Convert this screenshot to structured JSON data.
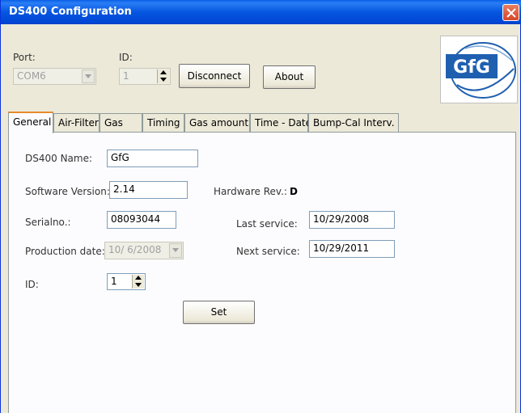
{
  "window": {
    "title": "DS400 Configuration"
  },
  "connection": {
    "port_label": "Port:",
    "port_value": "COM6",
    "id_label": "ID:",
    "id_value": "1",
    "disconnect_label": "Disconnect",
    "about_label": "About"
  },
  "logo": {
    "text": "GfG"
  },
  "tabs": [
    {
      "label": "General",
      "active": true
    },
    {
      "label": "Air-Filter",
      "active": false
    },
    {
      "label": "Gas",
      "active": false
    },
    {
      "label": "Timing",
      "active": false
    },
    {
      "label": "Gas amount",
      "active": false
    },
    {
      "label": "Time - Date",
      "active": false
    },
    {
      "label": "Bump-Cal Interv.",
      "active": false
    }
  ],
  "general": {
    "name_label": "DS400 Name:",
    "name_value": "GfG",
    "sw_label": "Software Version:",
    "sw_value": "2.14",
    "hw_label": "Hardware Rev.:",
    "hw_value": "D",
    "serial_label": "Serialno.:",
    "serial_value": "08093044",
    "last_service_label": "Last service:",
    "last_service_value": "10/29/2008",
    "prod_label": "Production date:",
    "prod_value": "10/ 6/2008",
    "next_service_label": "Next service:",
    "next_service_value": "10/29/2011",
    "id_label": "ID:",
    "id_value": "1",
    "set_label": "Set"
  },
  "colors": {
    "title_bar": "#0054e3",
    "tab_active_accent": "#e68b2c",
    "logo_blue": "#1f5fb0"
  }
}
